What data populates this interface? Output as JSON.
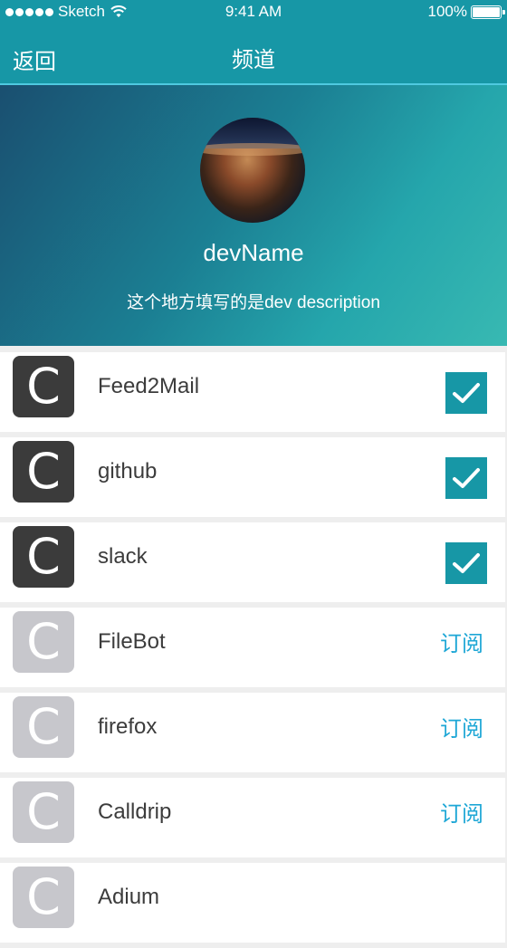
{
  "status_bar": {
    "carrier": "Sketch",
    "time": "9:41 AM",
    "battery": "100%"
  },
  "nav": {
    "back_label": "返回",
    "title": "频道"
  },
  "profile": {
    "name": "devName",
    "description": "这个地方填写的是dev description"
  },
  "channels": [
    {
      "icon_letter": "C",
      "name": "Feed2Mail",
      "subscribed": true
    },
    {
      "icon_letter": "C",
      "name": "github",
      "subscribed": true
    },
    {
      "icon_letter": "C",
      "name": "slack",
      "subscribed": true
    },
    {
      "icon_letter": "C",
      "name": "FileBot",
      "subscribed": false,
      "action_label": "订阅"
    },
    {
      "icon_letter": "C",
      "name": "firefox",
      "subscribed": false,
      "action_label": "订阅"
    },
    {
      "icon_letter": "C",
      "name": "Calldrip",
      "subscribed": false,
      "action_label": "订阅"
    },
    {
      "icon_letter": "C",
      "name": "Adium",
      "subscribed": false
    }
  ],
  "colors": {
    "nav": "#1797a6",
    "check": "#1797a6",
    "subscribe_text": "#1ea7d6",
    "icon_on": "#3b3b3b",
    "icon_off": "#c7c7cc"
  }
}
